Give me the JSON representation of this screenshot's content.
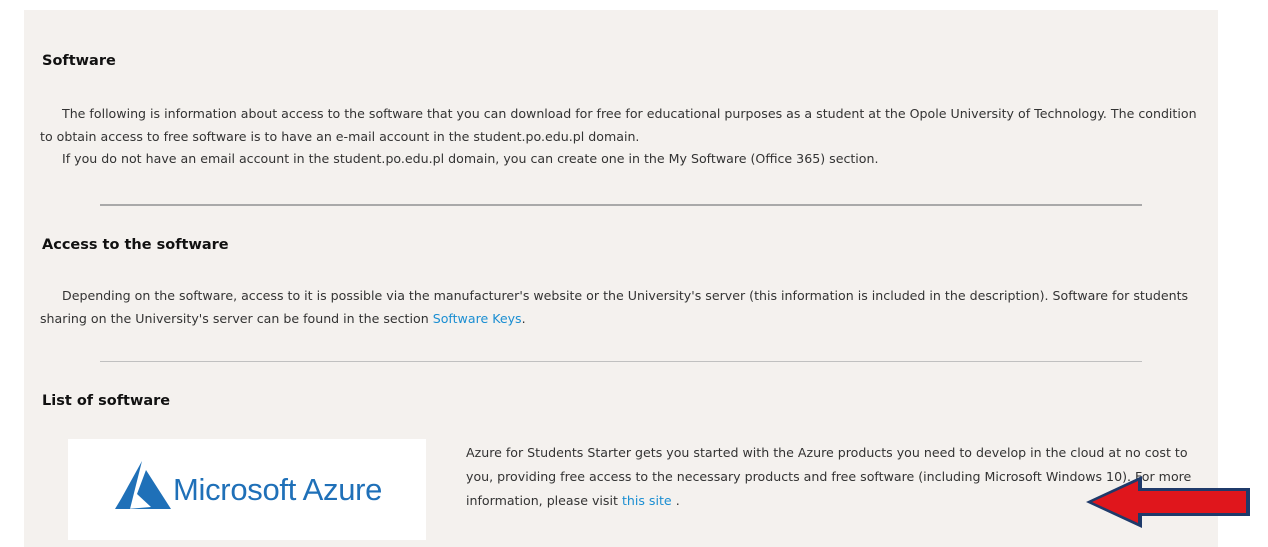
{
  "sections": {
    "software": {
      "heading": "Software",
      "line1": "The following is information about access to the software that you can download for free for educational purposes as a student at the Opole University of Technology. The condition to obtain access to free software is to have an e-mail account in the student.po.edu.pl domain.",
      "line2": "If you do not have an email account in the student.po.edu.pl domain, you can create one in the My Software (Office 365) section."
    },
    "access": {
      "heading": "Access to the software",
      "text": "Depending on the software, access to it is possible via the manufacturer's website or the University's server (this information is included in the description). Software for students sharing on the University's server can be found in the section",
      "link_label": "Software Keys",
      "after_link": "."
    },
    "list": {
      "heading": "List of software",
      "items": [
        {
          "logo_text": "Microsoft Azure",
          "logo_icon": "azure-logo-icon",
          "description": "Azure for Students Starter gets you started with the Azure products you need to develop in the cloud at no cost to you, providing free access to the necessary products and free software (including Microsoft Windows 10). For more information, please visit",
          "link_label": "this site",
          "after_link": "."
        }
      ]
    }
  },
  "annotations": {
    "arrow_icon": "red-left-arrow-icon",
    "arrow_color": "#e0161c",
    "arrow_outline": "#1f3a6a"
  },
  "colors": {
    "link": "#1a8ed2",
    "panel_background": "#f4f1ee",
    "azure_blue": "#1f70b8"
  }
}
